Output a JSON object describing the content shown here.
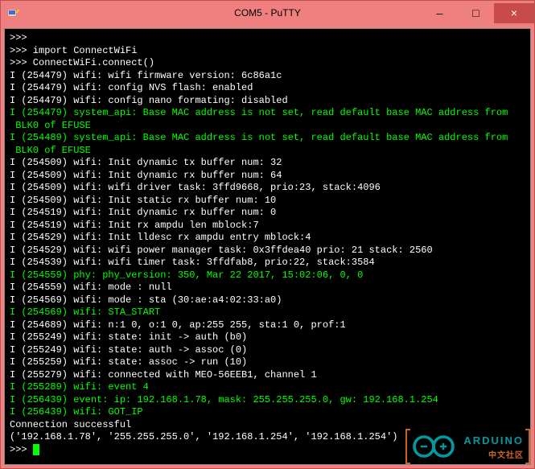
{
  "window": {
    "title": "COM5 - PuTTY",
    "icon": "putty-icon"
  },
  "controls": {
    "minimize": "–",
    "maximize": "□",
    "close": "×"
  },
  "terminal": {
    "lines": [
      {
        "color": "white",
        "text": ">>>"
      },
      {
        "color": "white",
        "text": ">>> import ConnectWiFi"
      },
      {
        "color": "white",
        "text": ">>> ConnectWiFi.connect()"
      },
      {
        "color": "white",
        "text": "I (254479) wifi: wifi firmware version: 6c86a1c"
      },
      {
        "color": "white",
        "text": "I (254479) wifi: config NVS flash: enabled"
      },
      {
        "color": "white",
        "text": "I (254479) wifi: config nano formating: disabled"
      },
      {
        "color": "green",
        "text": "I (254479) system_api: Base MAC address is not set, read default base MAC address from BLK0 of EFUSE"
      },
      {
        "color": "green",
        "text": "I (254489) system_api: Base MAC address is not set, read default base MAC address from BLK0 of EFUSE"
      },
      {
        "color": "white",
        "text": "I (254509) wifi: Init dynamic tx buffer num: 32"
      },
      {
        "color": "white",
        "text": "I (254509) wifi: Init dynamic rx buffer num: 64"
      },
      {
        "color": "white",
        "text": "I (254509) wifi: wifi driver task: 3ffd9668, prio:23, stack:4096"
      },
      {
        "color": "white",
        "text": "I (254509) wifi: Init static rx buffer num: 10"
      },
      {
        "color": "white",
        "text": "I (254519) wifi: Init dynamic rx buffer num: 0"
      },
      {
        "color": "white",
        "text": "I (254519) wifi: Init rx ampdu len mblock:7"
      },
      {
        "color": "white",
        "text": "I (254529) wifi: Init lldesc rx ampdu entry mblock:4"
      },
      {
        "color": "white",
        "text": "I (254529) wifi: wifi power manager task: 0x3ffdea40 prio: 21 stack: 2560"
      },
      {
        "color": "white",
        "text": "I (254539) wifi: wifi timer task: 3ffdfab8, prio:22, stack:3584"
      },
      {
        "color": "green",
        "text": "I (254559) phy: phy_version: 350, Mar 22 2017, 15:02:06, 0, 0"
      },
      {
        "color": "white",
        "text": "I (254559) wifi: mode : null"
      },
      {
        "color": "white",
        "text": "I (254569) wifi: mode : sta (30:ae:a4:02:33:a0)"
      },
      {
        "color": "green",
        "text": "I (254569) wifi: STA_START"
      },
      {
        "color": "white",
        "text": "I (254689) wifi: n:1 0, o:1 0, ap:255 255, sta:1 0, prof:1"
      },
      {
        "color": "white",
        "text": "I (255249) wifi: state: init -> auth (b0)"
      },
      {
        "color": "white",
        "text": "I (255249) wifi: state: auth -> assoc (0)"
      },
      {
        "color": "white",
        "text": "I (255259) wifi: state: assoc -> run (10)"
      },
      {
        "color": "white",
        "text": "I (255279) wifi: connected with MEO-56EEB1, channel 1"
      },
      {
        "color": "green",
        "text": "I (255289) wifi: event 4"
      },
      {
        "color": "green",
        "text": "I (256439) event: ip: 192.168.1.78, mask: 255.255.255.0, gw: 192.168.1.254"
      },
      {
        "color": "green",
        "text": "I (256439) wifi: GOT_IP"
      },
      {
        "color": "white",
        "text": "Connection successful"
      },
      {
        "color": "white",
        "text": "('192.168.1.78', '255.255.255.0', '192.168.1.254', '192.168.1.254')"
      }
    ],
    "prompt": ">>> "
  },
  "watermark": {
    "brand": "ARDUINO",
    "sub": "中文社区"
  }
}
